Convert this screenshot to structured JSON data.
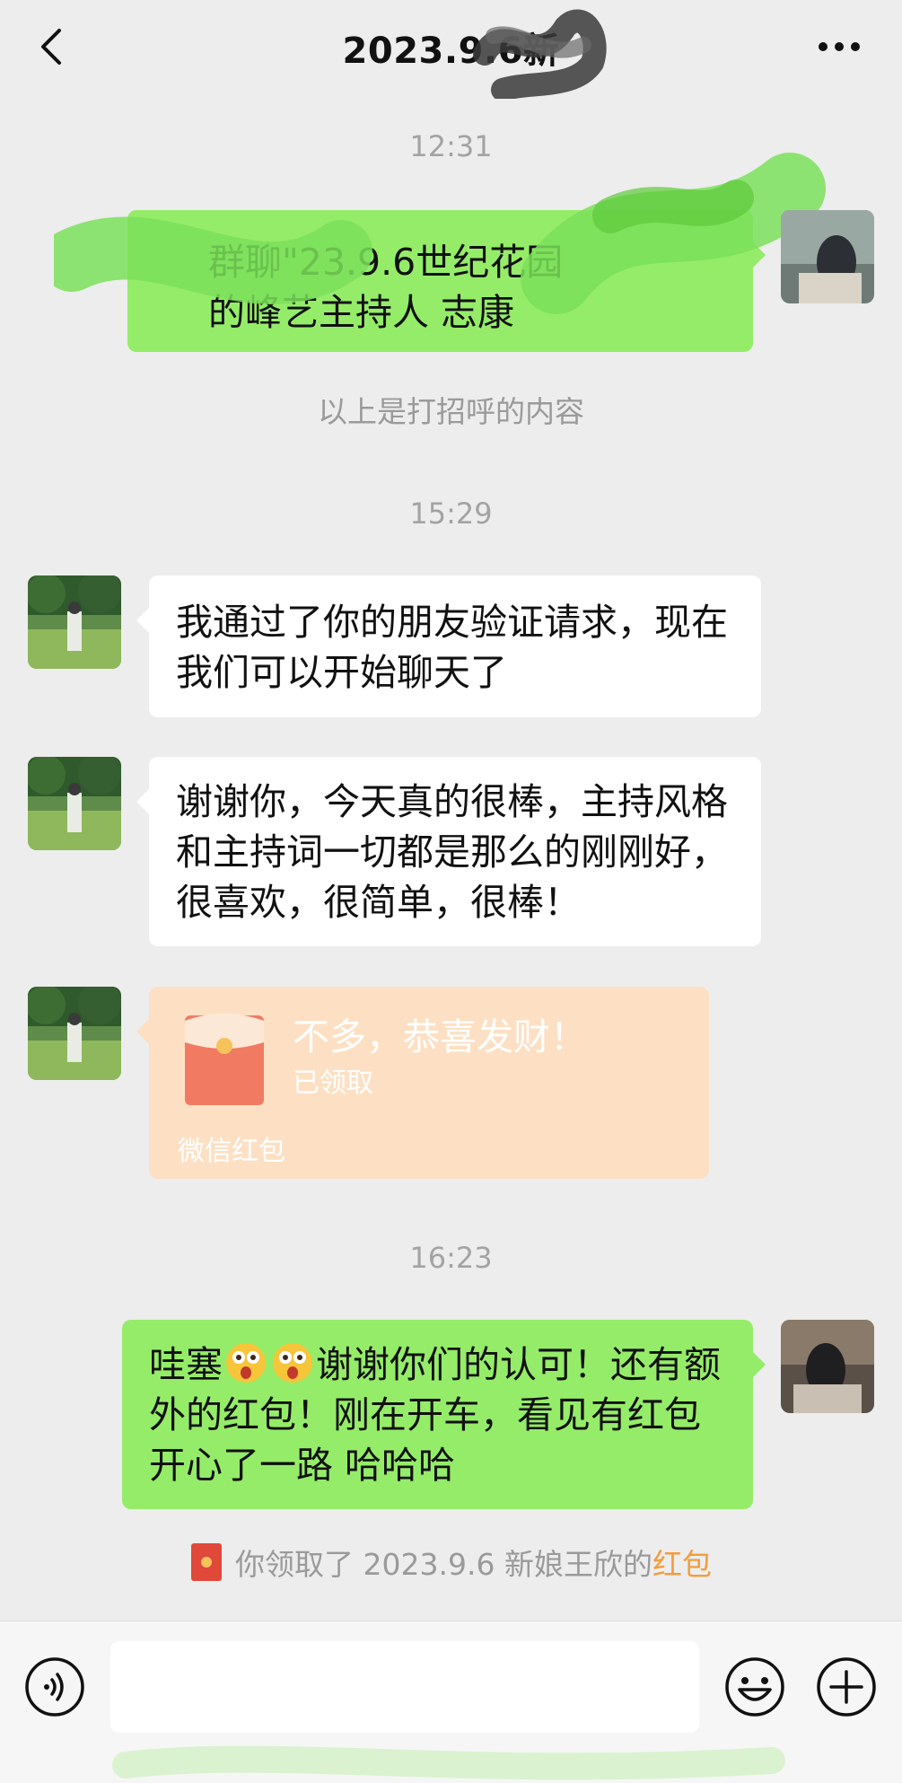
{
  "header": {
    "title": "2023.9.6新"
  },
  "messages": {
    "time1": "12:31",
    "greet_line1": "群聊\"23.9.6世纪花园",
    "greet_line2": "的峰艺主持人  志康",
    "greet_note": "以上是打招呼的内容",
    "time2": "15:29",
    "msg1": "我通过了你的朋友验证请求，现在我们可以开始聊天了",
    "msg2": "谢谢你，今天真的很棒，主持风格和主持词一切都是那么的刚刚好，很喜欢，很简单，很棒！",
    "redpacket": {
      "title": "不多，恭喜发财！",
      "status": "已领取",
      "footer": "微信红包"
    },
    "time3": "16:23",
    "reply_prefix": "哇塞",
    "reply_body": "谢谢你们的认可！还有额外的红包！刚在开车，看见有红包开心了一路 哈哈哈",
    "receipt_text": "你领取了 2023.9.6 新娘王欣的",
    "receipt_link": "红包"
  },
  "colors": {
    "background": "#ededed",
    "green_bubble": "#95ec69",
    "red_packet": "#fde0c3",
    "link": "#f39c3c"
  },
  "icons": [
    "back-icon",
    "more-icon",
    "voice-icon",
    "emoji-icon",
    "plus-icon",
    "red-packet-icon"
  ]
}
